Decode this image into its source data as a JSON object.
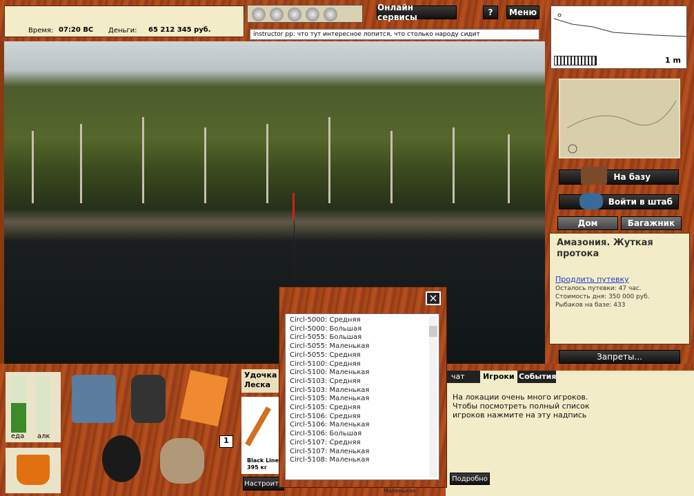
{
  "status": {
    "time_label": "Время:",
    "time_value": "07:20 ВС",
    "money_label": "Деньги:",
    "money_value": "65 212 345 руб."
  },
  "top": {
    "online_services": "Онлайн сервисы",
    "help": "?",
    "menu": "Меню"
  },
  "chat_line": "instructor pp: что тут интересное лопится, что столько народу сидит",
  "depth": {
    "value": "1 m"
  },
  "nav": {
    "to_base": "На базу",
    "enter_hq": "Войти в штаб",
    "home": "Дом",
    "trunk": "Багажник",
    "bans": "Запреты..."
  },
  "location": {
    "title": "Амазония. Жуткая протока",
    "extend_link": "Продлить путевку",
    "days_left": "Осталось путевки: 47 час.",
    "day_cost": "Стоимость дня: 350 000 руб.",
    "anglers": "Рыбаков на базе: 433"
  },
  "needs": {
    "food": "еда",
    "alc": "алк"
  },
  "badge": "1",
  "rod": {
    "tab1": "Удочка",
    "tab2": "Леска",
    "line_name": "Black Line",
    "line_weight": "395 кг",
    "settings": "Настроить"
  },
  "tabs": {
    "chat": "чат",
    "players": "Игроки",
    "events": "События"
  },
  "players_msg": "На локации очень много игроков. Чтобы посмотреть полный список игроков нажмите на эту надпись",
  "details": "Подробно",
  "bottom_cut": "Маленькая",
  "popup": {
    "close": "×",
    "items": [
      "Circl-5000: Средняя",
      "Circl-5000: Большая",
      "Circl-5055: Большая",
      "Circl-5055: Маленькая",
      "Circl-5055: Средняя",
      "Circl-5100: Средняя",
      "Circl-5100: Маленькая",
      "Circl-5103: Средняя",
      "Circl-5103: Маленькая",
      "Circl-5105: Маленькая",
      "Circl-5105: Средняя",
      "Circl-5106: Средняя",
      "Circl-5106: Маленькая",
      "Circl-5106: Большая",
      "Circl-5107: Средняя",
      "Circl-5107: Маленькая",
      "Circl-5108: Маленькая"
    ]
  }
}
